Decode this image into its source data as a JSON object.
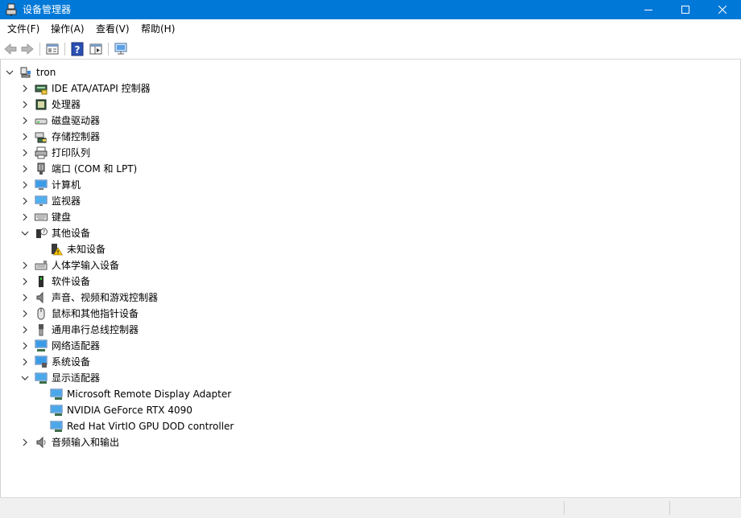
{
  "window": {
    "title": "设备管理器"
  },
  "menu": {
    "file": "文件(F)",
    "action": "操作(A)",
    "view": "查看(V)",
    "help": "帮助(H)"
  },
  "tree": {
    "root": "tron",
    "items": [
      {
        "label": "IDE ATA/ATAPI 控制器",
        "icon": "ide-controller-icon",
        "expanded": false
      },
      {
        "label": "处理器",
        "icon": "processor-icon",
        "expanded": false
      },
      {
        "label": "磁盘驱动器",
        "icon": "disk-drive-icon",
        "expanded": false
      },
      {
        "label": "存储控制器",
        "icon": "storage-controller-icon",
        "expanded": false
      },
      {
        "label": "打印队列",
        "icon": "printer-icon",
        "expanded": false
      },
      {
        "label": "端口 (COM 和 LPT)",
        "icon": "port-icon",
        "expanded": false
      },
      {
        "label": "计算机",
        "icon": "computer-icon",
        "expanded": false
      },
      {
        "label": "监视器",
        "icon": "monitor-icon",
        "expanded": false
      },
      {
        "label": "键盘",
        "icon": "keyboard-icon",
        "expanded": false
      },
      {
        "label": "其他设备",
        "icon": "unknown-device-icon",
        "expanded": true,
        "children": [
          {
            "label": "未知设备",
            "icon": "warning-device-icon"
          }
        ]
      },
      {
        "label": "人体学输入设备",
        "icon": "hid-icon",
        "expanded": false
      },
      {
        "label": "软件设备",
        "icon": "software-device-icon",
        "expanded": false
      },
      {
        "label": "声音、视频和游戏控制器",
        "icon": "speaker-icon",
        "expanded": false
      },
      {
        "label": "鼠标和其他指针设备",
        "icon": "mouse-icon",
        "expanded": false
      },
      {
        "label": "通用串行总线控制器",
        "icon": "usb-icon",
        "expanded": false
      },
      {
        "label": "网络适配器",
        "icon": "network-adapter-icon",
        "expanded": false
      },
      {
        "label": "系统设备",
        "icon": "system-device-icon",
        "expanded": false
      },
      {
        "label": "显示适配器",
        "icon": "display-adapter-icon",
        "expanded": true,
        "children": [
          {
            "label": "Microsoft Remote Display Adapter",
            "icon": "display-adapter-icon"
          },
          {
            "label": "NVIDIA GeForce RTX 4090",
            "icon": "display-adapter-icon"
          },
          {
            "label": "Red Hat VirtIO GPU DOD controller",
            "icon": "display-adapter-icon"
          }
        ]
      },
      {
        "label": "音频输入和输出",
        "icon": "audio-io-icon",
        "expanded": false
      }
    ]
  },
  "colors": {
    "titlebar": "#0078d7",
    "accent": "#1e90ff"
  }
}
